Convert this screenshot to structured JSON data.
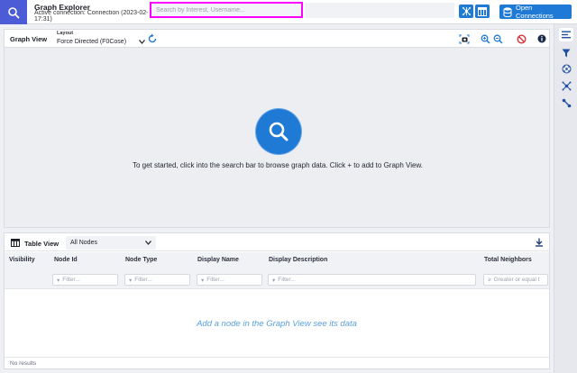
{
  "header": {
    "app_title": "Graph Explorer",
    "connection_line1": "Active connection: Connection (2023-02-13",
    "connection_line2": "17:31)",
    "search_placeholder": "Search by Interest, Username...",
    "open_connections_label": "Open Connections",
    "icons": [
      "search-icon",
      "graph-view-toggle-icon",
      "table-view-toggle-icon",
      "database-icon"
    ]
  },
  "graph_view": {
    "title": "Graph View",
    "layout_label": "Layout",
    "layout_value": "Force Directed (F0Cose)",
    "empty_message": "To get started, click into the search bar to browse graph data. Click + to add to Graph View.",
    "tools": [
      "screenshot-icon",
      "zoom-in-icon",
      "zoom-out-icon",
      "clear-graph-icon",
      "info-icon"
    ]
  },
  "table_view": {
    "title": "Table View",
    "nodes_select_value": "All Nodes",
    "columns": [
      {
        "label": "Visibility",
        "filter": ""
      },
      {
        "label": "Node Id",
        "filter": "Filter..."
      },
      {
        "label": "Node Type",
        "filter": "Filter..."
      },
      {
        "label": "Display Name",
        "filter": "Filter..."
      },
      {
        "label": "Display Description",
        "filter": "Filter..."
      },
      {
        "label": "Total Neighbors",
        "filter": "Greater or equal t"
      }
    ],
    "empty_message": "Add a node in the Graph View see its data",
    "footer": "No results"
  },
  "sidebar": {
    "items": [
      "details-icon",
      "filter-icon",
      "expand-icon",
      "node-styling-icon",
      "edge-styling-icon"
    ]
  },
  "colors": {
    "accent": "#1f7ad6",
    "logo": "#4b5cd6",
    "highlight": "#ff00ff",
    "danger": "#e0313a"
  }
}
